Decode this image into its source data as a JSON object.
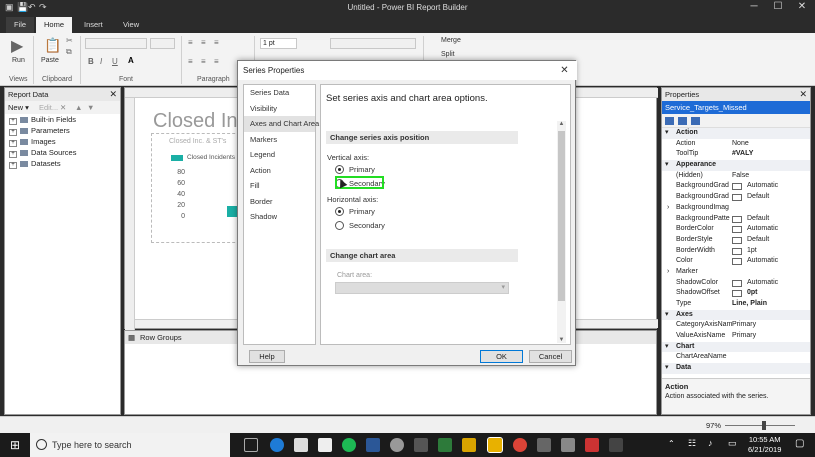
{
  "window": {
    "title": "Untitled - Power BI Report Builder"
  },
  "ribbon": {
    "tabs": [
      "File",
      "Home",
      "Insert",
      "View"
    ],
    "groups": {
      "views": "Views",
      "clipboard": "Clipboard",
      "font": "Font",
      "paragraph": "Paragraph"
    },
    "run_label": "Run",
    "paste_label": "Paste",
    "border_width": "1 pt",
    "merge_label": "Merge",
    "split_label": "Split"
  },
  "report_data": {
    "title": "Report Data",
    "new_label": "New",
    "edit_label": "Edit...",
    "items": [
      "Built-in Fields",
      "Parameters",
      "Images",
      "Data Sources",
      "Datasets"
    ]
  },
  "design": {
    "report_title": "Closed Inc",
    "subtitle": "Closed Inc. & ST's",
    "legend_label": "Closed Incidents",
    "row_groups_label": "Row Groups"
  },
  "chart_data": {
    "type": "bar",
    "ylim": [
      0,
      80
    ],
    "ticks": [
      "80",
      "60",
      "40",
      "20",
      "0"
    ],
    "series": [
      {
        "name": "Closed Incidents",
        "values": [
          20
        ]
      }
    ]
  },
  "properties": {
    "title": "Properties",
    "object": "Service_Targets_Missed",
    "rows": [
      {
        "type": "cat",
        "label": "Action"
      },
      {
        "type": "prop",
        "key": "Action",
        "value": "None"
      },
      {
        "type": "prop",
        "key": "ToolTip",
        "value": "#VALY",
        "bold": true
      },
      {
        "type": "cat",
        "label": "Appearance"
      },
      {
        "type": "prop",
        "key": "(Hidden)",
        "value": "False"
      },
      {
        "type": "prop",
        "key": "BackgroundGrad",
        "value": "Automatic",
        "swatch": true
      },
      {
        "type": "prop",
        "key": "BackgroundGrad",
        "value": "Default",
        "swatch": true
      },
      {
        "type": "prop",
        "key": "BackgroundImag",
        "value": "",
        "expand": true
      },
      {
        "type": "prop",
        "key": "BackgroundPatte",
        "value": "Default",
        "swatch": true
      },
      {
        "type": "prop",
        "key": "BorderColor",
        "value": "Automatic",
        "swatch": true
      },
      {
        "type": "prop",
        "key": "BorderStyle",
        "value": "Default",
        "swatch": true
      },
      {
        "type": "prop",
        "key": "BorderWidth",
        "value": "1pt",
        "swatch": true
      },
      {
        "type": "prop",
        "key": "Color",
        "value": "Automatic",
        "swatch": true
      },
      {
        "type": "prop",
        "key": "Marker",
        "value": "",
        "expand": true
      },
      {
        "type": "prop",
        "key": "ShadowColor",
        "value": "Automatic",
        "swatch": true
      },
      {
        "type": "prop",
        "key": "ShadowOffset",
        "value": "0pt",
        "swatch": true,
        "bold": true
      },
      {
        "type": "prop",
        "key": "Type",
        "value": "Line, Plain",
        "bold": true
      },
      {
        "type": "cat",
        "label": "Axes"
      },
      {
        "type": "prop",
        "key": "CategoryAxisNam",
        "value": "Primary"
      },
      {
        "type": "prop",
        "key": "ValueAxisName",
        "value": "Primary"
      },
      {
        "type": "cat",
        "label": "Chart"
      },
      {
        "type": "prop",
        "key": "ChartAreaName",
        "value": ""
      },
      {
        "type": "cat",
        "label": "Data"
      }
    ],
    "description_title": "Action",
    "description_text": "Action associated with the series."
  },
  "dialog": {
    "title": "Series Properties",
    "nav": [
      "Series Data",
      "Visibility",
      "Axes and Chart Area",
      "Markers",
      "Legend",
      "Action",
      "Fill",
      "Border",
      "Shadow"
    ],
    "selected_nav": "Axes and Chart Area",
    "heading": "Set series axis and chart area options.",
    "section_axis": "Change series axis position",
    "vertical_axis_label": "Vertical axis:",
    "horizontal_axis_label": "Horizontal axis:",
    "primary_label": "Primary",
    "secondary_label": "Secondary",
    "section_area": "Change chart area",
    "chart_area_label": "Chart area:",
    "help_label": "Help",
    "ok_label": "OK",
    "cancel_label": "Cancel"
  },
  "status": {
    "zoom": "97%"
  },
  "taskbar": {
    "search_placeholder": "Type here to search",
    "time": "10:55 AM",
    "date": "6/21/2019"
  },
  "colors": {
    "accent": "#1e6bd6",
    "highlight": "#22dd22",
    "bar": "#1aafa5"
  }
}
